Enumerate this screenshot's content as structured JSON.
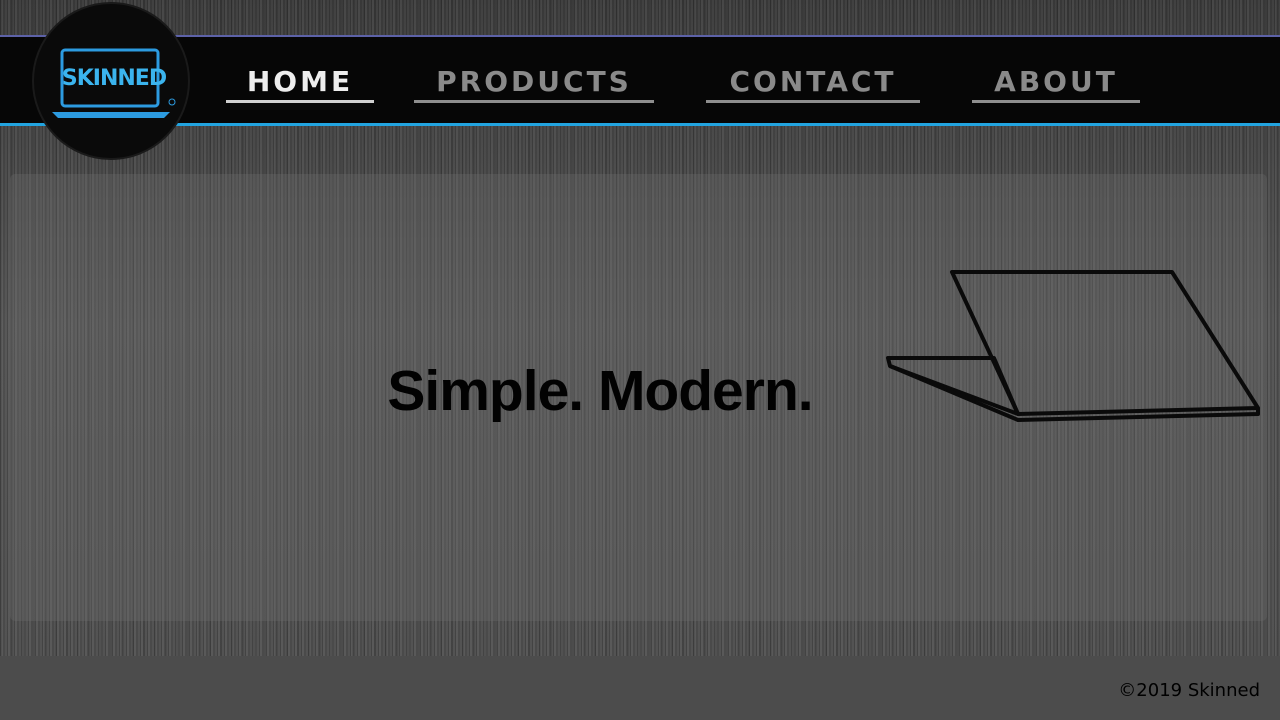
{
  "brand": {
    "name": "SKINNED",
    "logo_icon": "laptop-logo-icon"
  },
  "nav": {
    "items": [
      {
        "label": "HOME",
        "active": true
      },
      {
        "label": "PRODUCTS",
        "active": false
      },
      {
        "label": "CONTACT",
        "active": false
      },
      {
        "label": "ABOUT",
        "active": false
      }
    ]
  },
  "hero": {
    "title": "Simple. Modern.",
    "illustration": "laptop-illustration"
  },
  "footer": {
    "copyright": "©2019 Skinned"
  },
  "colors": {
    "accent_blue": "#22a4e0",
    "accent_purple": "#5d62a8",
    "header_bg": "#060606",
    "active_nav": "#ededed",
    "inactive_nav": "#8a8a8a"
  }
}
